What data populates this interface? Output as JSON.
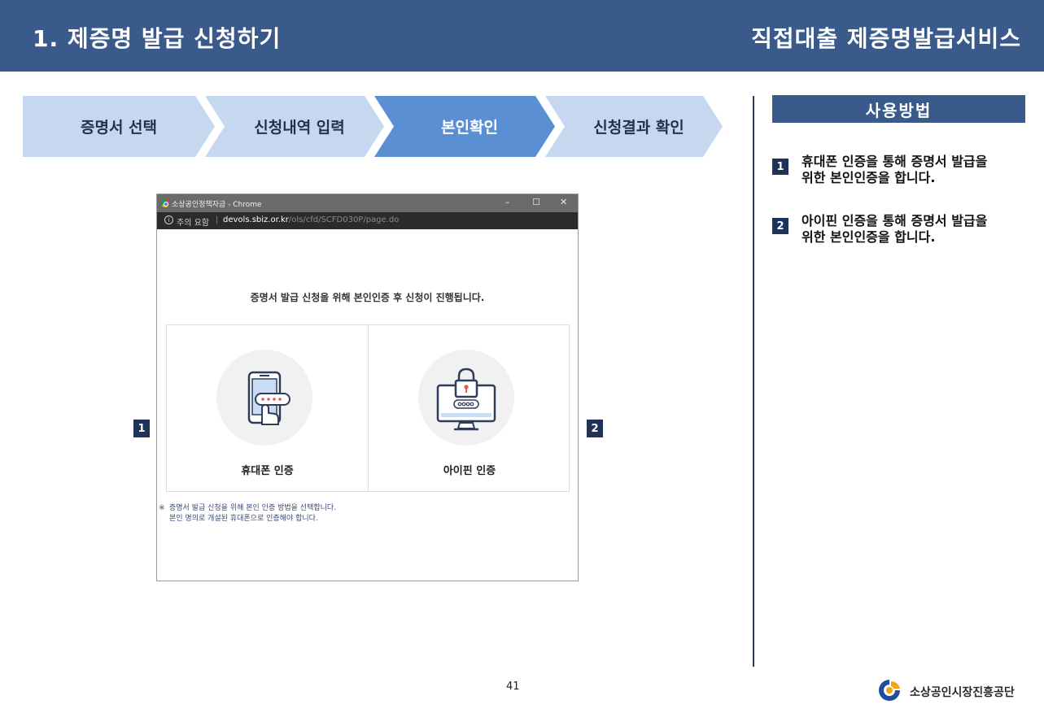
{
  "header": {
    "title": "1. 제증명 발급 신청하기",
    "service": "직접대출 제증명발급서비스"
  },
  "steps": [
    {
      "label": "증명서 선택",
      "active": false
    },
    {
      "label": "신청내역 입력",
      "active": false
    },
    {
      "label": "본인확인",
      "active": true
    },
    {
      "label": "신청결과 확인",
      "active": false
    }
  ],
  "colors": {
    "header_bg": "#3a5a8c",
    "step_inactive": "#c5d8ef",
    "step_active": "#5b8fd4",
    "badge": "#1e3357"
  },
  "browser": {
    "window_title": "소상공인정책자금 - Chrome",
    "controls": {
      "minimize": "–",
      "maximize": "☐",
      "close": "✕"
    },
    "security_label": "주의 요함",
    "url_host": "devols.sbiz.or.kr",
    "url_path": "/ols/cfd/SCFD030P/page.do",
    "message": "증명서 발급 신청을 위해 본인인증 후 신청이 진행됩니다.",
    "options": [
      {
        "label": "휴대폰 인증",
        "icon": "phone-auth-icon"
      },
      {
        "label": "아이핀 인증",
        "icon": "ipin-monitor-lock-icon"
      }
    ],
    "footnote_mark": "※",
    "footnote_line1": "증명서 발급 신청을 위해 본인 인증 방법을 선택합니다.",
    "footnote_line2": "본인 명의로 개설된 휴대폰으로 인증해야 합니다."
  },
  "markers": [
    "1",
    "2"
  ],
  "usage": {
    "title": "사용방법",
    "items": [
      {
        "num": "1",
        "line1": "휴대폰 인증을 통해 증명서 발급을",
        "line2": "위한 본인인증을 합니다."
      },
      {
        "num": "2",
        "line1": "아이핀 인증을 통해 증명서 발급을",
        "line2": "위한 본인인증을 합니다."
      }
    ]
  },
  "footer": {
    "page_number": "41",
    "logo_text": "소상공인시장진흥공단"
  }
}
